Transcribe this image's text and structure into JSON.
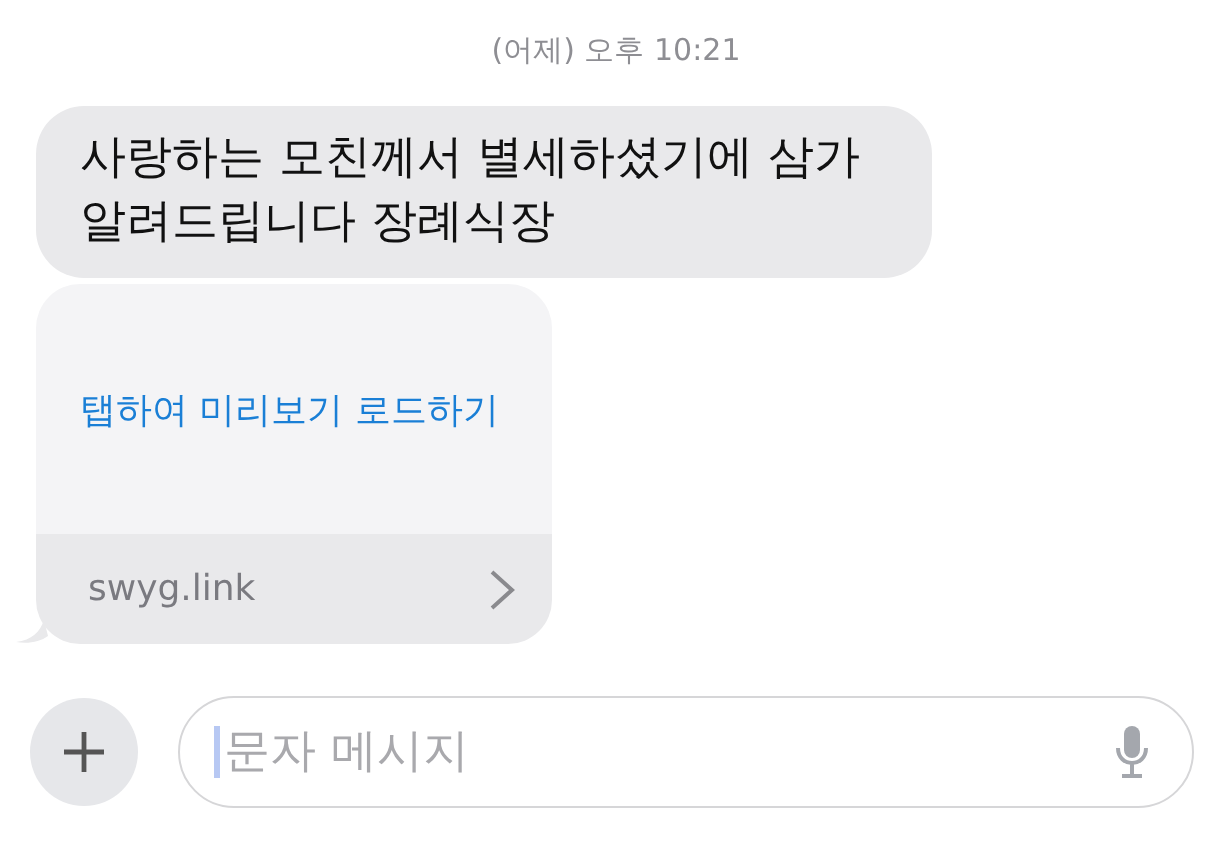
{
  "timestamp": "(어제) 오후 10:21",
  "messages": [
    {
      "kind": "text",
      "text": "사랑하는 모친께서 별세하셨기에 삼가\n알려드립니다 장례식장",
      "tail": false
    },
    {
      "kind": "link",
      "action": "탭하여 미리보기 로드하기",
      "domain": "swyg.link",
      "tail": true
    }
  ],
  "composer": {
    "placeholder": "문자 메시지",
    "focused": true
  }
}
